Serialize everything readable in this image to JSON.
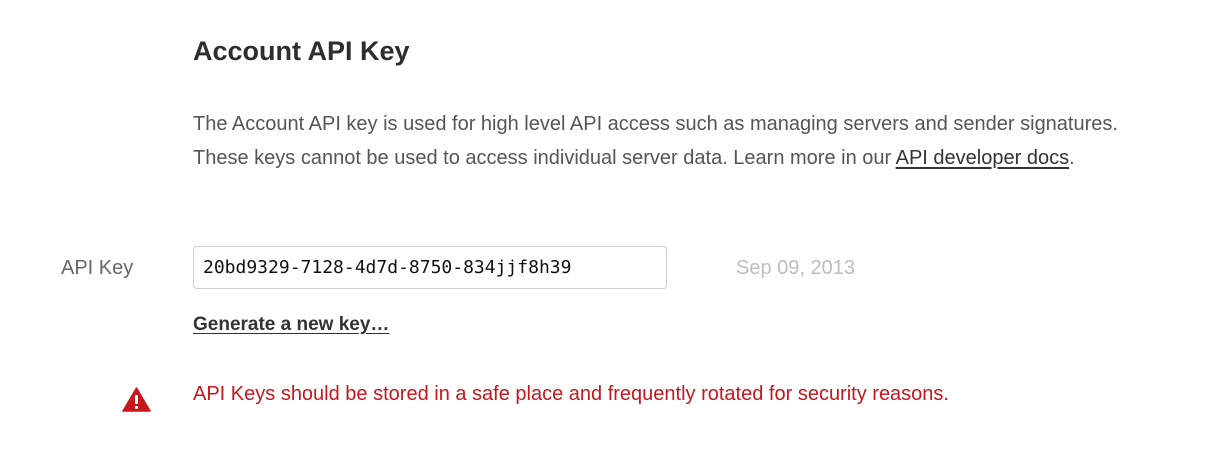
{
  "section": {
    "title": "Account API Key",
    "description_text": "The Account API key is used for high level API access such as managing servers and sender signatures. These keys cannot be used to access individual server data. Learn more in our ",
    "docs_link_label": "API developer docs",
    "description_end": "."
  },
  "api_key": {
    "label": "API Key",
    "value": "20bd9329-7128-4d7d-8750-834jjf8h39",
    "created_date": "Sep 09, 2013",
    "generate_label": "Generate a new key…"
  },
  "warning": {
    "icon": "warning-triangle-icon",
    "text": "API Keys should be stored in a safe place and frequently rotated for security reasons.",
    "color": "#c8161d"
  }
}
